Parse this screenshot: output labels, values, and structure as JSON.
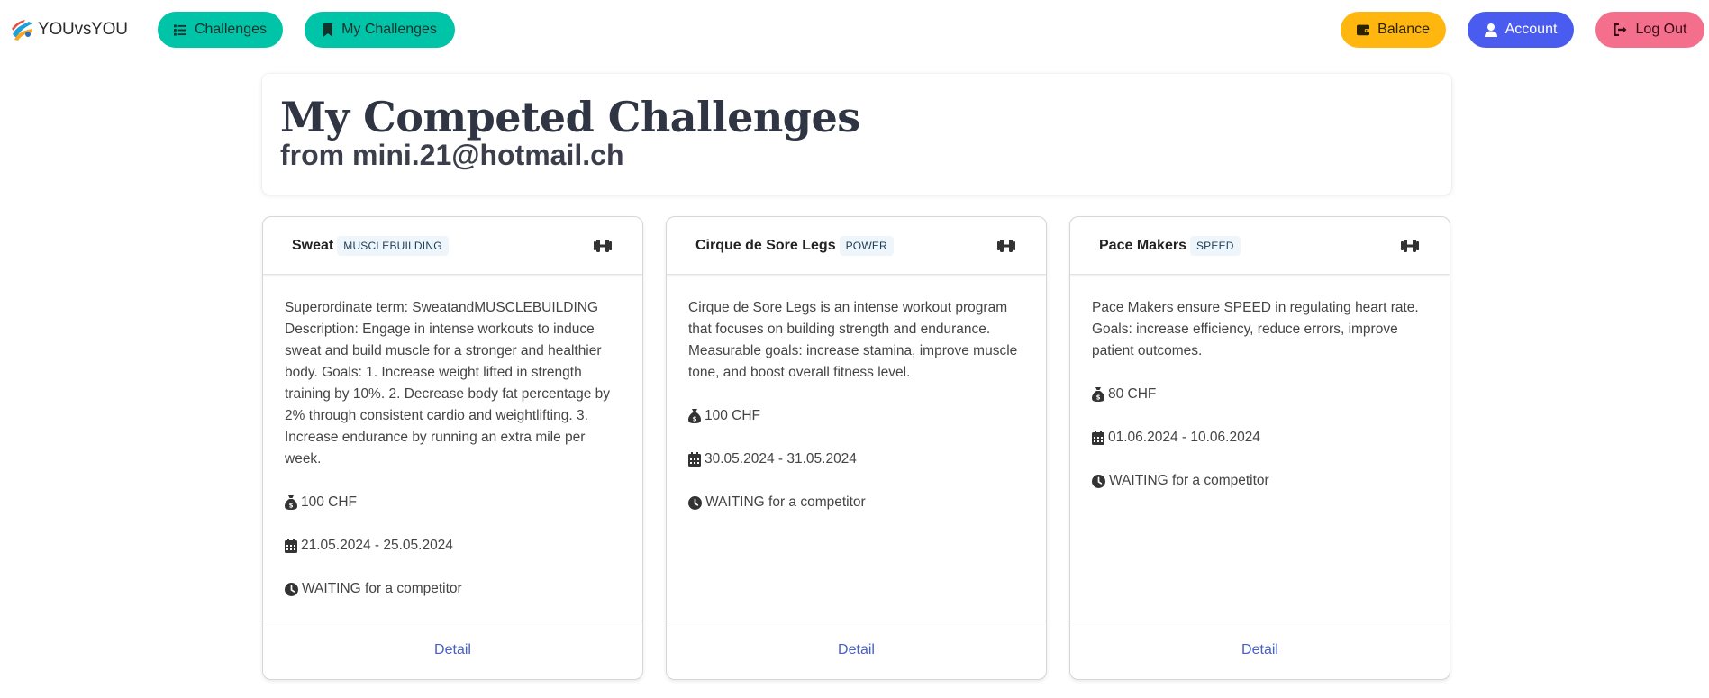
{
  "brand": {
    "name": "YOUvsYOU"
  },
  "nav": {
    "challenges_label": "Challenges",
    "my_challenges_label": "My Challenges",
    "balance_label": "Balance",
    "account_label": "Account",
    "logout_label": "Log Out"
  },
  "header": {
    "title": "My Competed Challenges",
    "subtitle": "from mini.21@hotmail.ch"
  },
  "cards": [
    {
      "title": "Sweat",
      "tag": "MUSCLEBUILDING",
      "description": "Superordinate term: SweatandMUSCLEBUILDING Description: Engage in intense workouts to induce sweat and build muscle for a stronger and healthier body. Goals: 1. Increase weight lifted in strength training by 10%. 2. Decrease body fat percentage by 2% through consistent cardio and weightlifting. 3. Increase endurance by running an extra mile per week.",
      "amount": "100 CHF",
      "dates": "21.05.2024 - 25.05.2024",
      "status": "WAITING for a competitor",
      "detail_label": "Detail"
    },
    {
      "title": "Cirque de Sore Legs",
      "tag": "POWER",
      "description": "Cirque de Sore Legs is an intense workout program that focuses on building strength and endurance. Measurable goals: increase stamina, improve muscle tone, and boost overall fitness level.",
      "amount": "100 CHF",
      "dates": "30.05.2024 - 31.05.2024",
      "status": "WAITING for a competitor",
      "detail_label": "Detail"
    },
    {
      "title": "Pace Makers",
      "tag": "SPEED",
      "description": "Pace Makers ensure SPEED in regulating heart rate. Goals: increase efficiency, reduce errors, improve patient outcomes.",
      "amount": "80 CHF",
      "dates": "01.06.2024 - 10.06.2024",
      "status": "WAITING for a competitor",
      "detail_label": "Detail"
    }
  ],
  "icons": {
    "challenges": "list-icon",
    "my_challenges": "bookmark-icon",
    "balance": "wallet-icon",
    "account": "user-icon",
    "logout": "sign-out-icon",
    "card_header": "dumbbell-icon",
    "amount": "money-bag-icon",
    "dates": "calendar-icon",
    "status": "clock-icon"
  },
  "colors": {
    "primary": "#00c4a7",
    "warning": "#ffb70f",
    "link": "#485fc7",
    "account": "#4a5cf0",
    "danger": "#f36f8c"
  }
}
